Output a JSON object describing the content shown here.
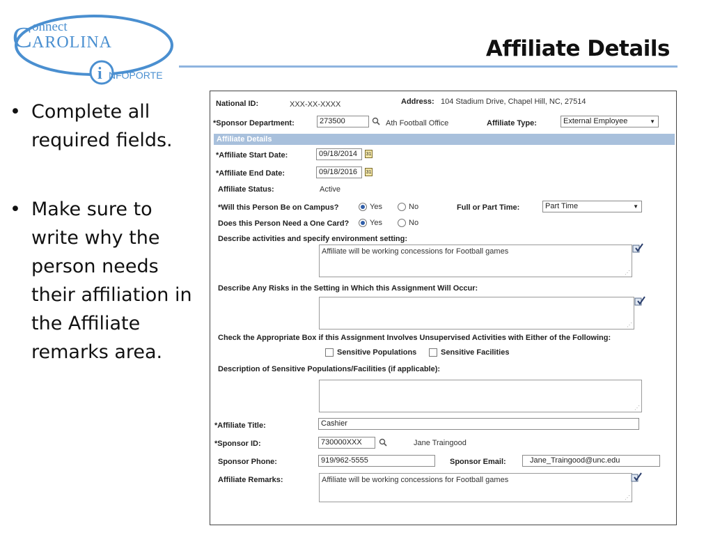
{
  "slide": {
    "title": "Affiliate Details",
    "logo": {
      "connect": "onnect",
      "carolina": "AROLINA",
      "infoporte": "NFOPORTE"
    },
    "bullets": [
      "Complete all required fields.",
      "Make sure to write why the person needs their affiliation in the Affiliate remarks area."
    ]
  },
  "form": {
    "national_id": {
      "label": "National ID:",
      "value": "XXX-XX-XXXX"
    },
    "address": {
      "label": "Address:",
      "value": "104 Stadium Drive, Chapel Hill, NC, 27514"
    },
    "sponsor_department": {
      "label": "*Sponsor Department:",
      "value": "273500",
      "description": "Ath Football Office"
    },
    "affiliate_type": {
      "label": "Affiliate Type:",
      "value": "External Employee"
    },
    "section_title": "Affiliate Details",
    "start_date": {
      "label": "*Affiliate Start Date:",
      "value": "09/18/2014"
    },
    "end_date": {
      "label": "*Affiliate End Date:",
      "value": "09/18/2016"
    },
    "status": {
      "label": "Affiliate Status:",
      "value": "Active"
    },
    "on_campus": {
      "label": "*Will this Person Be on Campus?",
      "yes": "Yes",
      "no": "No",
      "selected": "Yes"
    },
    "full_part": {
      "label": "Full or Part Time:",
      "value": "Part Time"
    },
    "one_card": {
      "label": "Does this Person Need a One Card?",
      "yes": "Yes",
      "no": "No",
      "selected": "Yes"
    },
    "activities": {
      "label": "Describe activities and specify environment setting:",
      "value": "Affiliate will be working concessions for Football games"
    },
    "risks": {
      "label": "Describe Any Risks in the Setting in Which this Assignment Will Occur:",
      "value": ""
    },
    "unsupervised": {
      "label": "Check the Appropriate Box if this Assignment Involves Unsupervised Activities with Either of the Following:",
      "sensitive_populations": "Sensitive Populations",
      "sensitive_facilities": "Sensitive Facilities"
    },
    "sensitive_desc": {
      "label": "Description of Sensitive Populations/Facilities (if applicable):",
      "value": ""
    },
    "affiliate_title": {
      "label": "*Affiliate Title:",
      "value": "Cashier"
    },
    "sponsor_id": {
      "label": "*Sponsor ID:",
      "value": "730000XXX",
      "name": "Jane Traingood"
    },
    "sponsor_phone": {
      "label": "Sponsor Phone:",
      "value": "919/962-5555"
    },
    "sponsor_email": {
      "label": "Sponsor Email:",
      "value": "Jane_Traingood@unc.edu"
    },
    "remarks": {
      "label": "Affiliate Remarks:",
      "value": "Affiliate will be working concessions for Football games"
    }
  },
  "icons": {
    "search": "magnifier-icon",
    "calendar": "calendar-icon",
    "spellcheck": "spellcheck-icon"
  },
  "colors": {
    "section_bar": "#a8c0dc",
    "title_rule": "#8eb4df",
    "logo_blue": "#4a8fd0"
  }
}
